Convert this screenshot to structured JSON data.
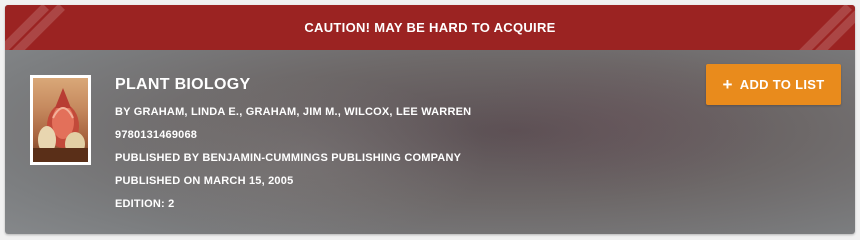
{
  "banner": {
    "text": "CAUTION! MAY BE HARD TO ACQUIRE"
  },
  "book": {
    "title": "PLANT BIOLOGY",
    "authors": "BY GRAHAM, LINDA E., GRAHAM, JIM M., WILCOX, LEE WARREN",
    "isbn": "9780131469068",
    "publisher": "PUBLISHED BY BENJAMIN-CUMMINGS PUBLISHING COMPANY",
    "published_on": "PUBLISHED ON MARCH 15, 2005",
    "edition": "EDITION: 2"
  },
  "actions": {
    "add_label": "ADD TO LIST",
    "add_icon": "plus-icon"
  },
  "colors": {
    "banner": "#9b2322",
    "button": "#e98b1c",
    "text": "#ffffff"
  }
}
